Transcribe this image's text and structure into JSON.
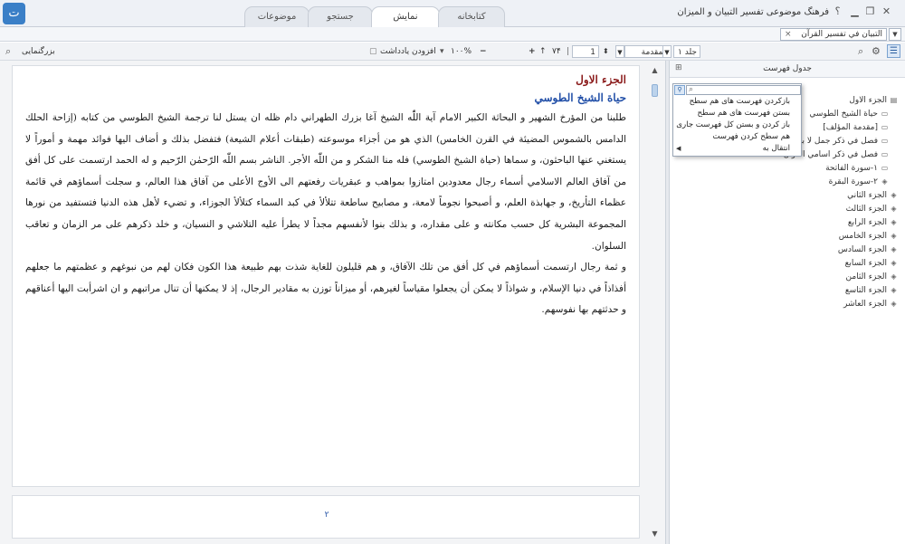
{
  "window": {
    "title": "فرهنگ موضوعی تفسیر التبیان و المیزان",
    "help_glyph": "؟"
  },
  "tabs": [
    {
      "label": "کتابخانه",
      "active": false
    },
    {
      "label": "نمایش",
      "active": true
    },
    {
      "label": "جستجو",
      "active": false
    },
    {
      "label": "موضوعات",
      "active": false
    }
  ],
  "doc_tab": {
    "label": "التبيان في تفسير القرآن",
    "close": "×"
  },
  "toolbar": {
    "enlarge_label": "بزرگنمایی",
    "add_note_label": "افزودن یادداشت",
    "zoom_value": "۱۰۰%",
    "page_current": "1",
    "page_total": "۷۴",
    "section_value": "المقدمة",
    "volume_value": "جلد ۱"
  },
  "document": {
    "heading1": "الجزء الاول",
    "heading2": "حياة الشيخ الطوسي",
    "paragraphs": [
      "طلبنا من المؤرخ الشهير و البحاثة الكبير الامام آية اللّٰه الشيخ آغا بزرك الطهراني دام ظله ان يستل لنا ترجمة الشيخ الطوسي من كتابه (إزاحة الحلك الدامس بالشموس المضيئة في القرن الخامس) الذي هو من أجزاء موسوعته (طبقات أعلام الشيعة) فتفضل بذلك و أضاف اليها فوائد مهمة و أموراً لا يستغني عنها الباحثون، و سماها (حياة الشيخ الطوسي) فله منا الشكر و من اللّٰه الأجر. الناشر بسم اللّٰه الرّحمٰن الرّحيم و له الحمد ارتسمت على كل أفق من آفاق العالم الاسلامي أسماء رجال معدودين امتازوا بمواهب و عبقريات رفعتهم الى الأوج الأعلى من آفاق هذا العالم، و سجلت أسماؤهم في قائمة عظماء التأريخ، و جهابذة العلم، و أصبحوا نجوماً لامعة، و مصابيح ساطعة تتلألأ في كبد السماء كتلألأ الجوزاء، و تضيء لأهل هذه الدنيا فتستفيد من نورها المجموعة البشرية كل حسب مكانته و على مقداره، و بذلك بنوا لأنفسهم مجداً لا يطرأ عليه التلاشي و النسيان، و خلد ذكرهم على مر الزمان و تعاقب السلوان.",
      "و ثمة رجال ارتسمت أسماؤهم في كل أفق من تلك الآفاق، و هم قليلون للغاية شذت بهم طبيعة هذا الكون فكان لهم من نبوغهم و عظمتهم ما جعلهم أفذاذاً في دنيا الإسلام، و شواذاً لا يمكن أن يجعلوا مقياساً لغيرهم، أو ميزاناً توزن به مقادير الرجال، إذ لا يمكنها أن تنال مراتبهم و ان اشرأبت اليها أعناقهم و حدثتهم بها نفوسهم."
    ],
    "page_number": "۲"
  },
  "toc_panel": {
    "title": "جدول فهرست",
    "items": [
      {
        "label": "الجزء الاول",
        "icon": "book-open-icon"
      },
      {
        "label": "حياة الشيخ الطوسي",
        "icon": "page-icon"
      },
      {
        "label": "[مقدمة المؤلف]",
        "icon": "page-icon"
      },
      {
        "label": "فصل في ذكر جمل لا بد",
        "icon": "page-icon"
      },
      {
        "label": "فصل في ذكر اسامي القرآن",
        "icon": "page-icon"
      },
      {
        "label": "۱-سورة الفاتحة",
        "icon": "page-icon"
      },
      {
        "label": "۲-سورة البقرة",
        "icon": "book-closed-icon"
      },
      {
        "label": "الجزء الثاني",
        "icon": "book-closed-icon"
      },
      {
        "label": "الجزء الثالث",
        "icon": "book-closed-icon"
      },
      {
        "label": "الجزء الرابع",
        "icon": "book-closed-icon"
      },
      {
        "label": "الجزء الخامس",
        "icon": "book-closed-icon"
      },
      {
        "label": "الجزء السادس",
        "icon": "book-closed-icon"
      },
      {
        "label": "الجزء السابع",
        "icon": "book-closed-icon"
      },
      {
        "label": "الجزء الثامن",
        "icon": "book-closed-icon"
      },
      {
        "label": "الجزء التاسع",
        "icon": "book-closed-icon"
      },
      {
        "label": "الجزء العاشر",
        "icon": "book-closed-icon"
      }
    ]
  },
  "context_menu": {
    "items": [
      "بازکردن فهرست های هم سطح",
      "بستن فهرست های هم سطح",
      "باز کردن و بستن کل فهرست جاری",
      "هم سطح کردن فهرست",
      "انتقال به"
    ]
  },
  "colors": {
    "heading1": "#8b1c1c",
    "heading2": "#2350a8",
    "accent": "#3a7fc7"
  }
}
